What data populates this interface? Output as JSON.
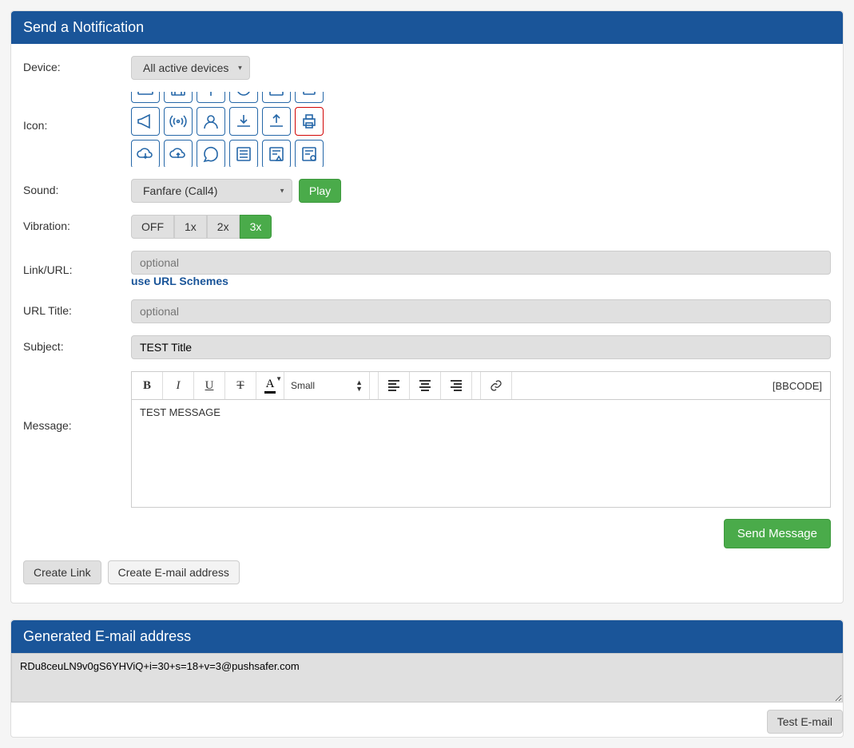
{
  "panel1": {
    "title": "Send a Notification"
  },
  "labels": {
    "device": "Device:",
    "icon": "Icon:",
    "sound": "Sound:",
    "vibration": "Vibration:",
    "linkurl": "Link/URL:",
    "urltitle": "URL Title:",
    "subject": "Subject:",
    "message": "Message:"
  },
  "device": {
    "selected": "All active devices"
  },
  "sound": {
    "selected": "Fanfare (Call4)",
    "play": "Play"
  },
  "vibration": {
    "off": "OFF",
    "x1": "1x",
    "x2": "2x",
    "x3": "3x",
    "active": "3x"
  },
  "linkurl": {
    "placeholder": "optional",
    "schemes": "use URL Schemes"
  },
  "urltitle": {
    "placeholder": "optional"
  },
  "subject": {
    "value": "TEST Title"
  },
  "editor": {
    "size": "Small",
    "bbcode": "[BBCODE]",
    "content": "TEST MESSAGE"
  },
  "buttons": {
    "send": "Send Message",
    "createLink": "Create Link",
    "createEmail": "Create E-mail address",
    "testEmail": "Test E-mail"
  },
  "panel2": {
    "title": "Generated E-mail address"
  },
  "generated": {
    "value": "RDu8ceuLN9v0gS6YHViQ+i=30+s=18+v=3@pushsafer.com"
  }
}
